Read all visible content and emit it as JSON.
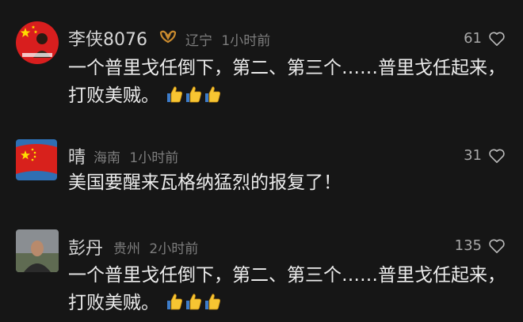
{
  "comments": [
    {
      "username": "李侠8076",
      "location": "辽宁",
      "time": "1小时前",
      "likes": "61",
      "text": "一个普里戈任倒下，第二、第三个……普里戈任起来，打败美贼。",
      "emoji": "thumbs-up x3",
      "badge": "sparkle-badge-icon"
    },
    {
      "username": "晴",
      "location": "海南",
      "time": "1小时前",
      "likes": "31",
      "text": "美国要醒来瓦格纳猛烈的报复了！"
    },
    {
      "username": "彭丹",
      "location": "贵州",
      "time": "2小时前",
      "likes": "135",
      "text": "一个普里戈任倒下，第二、第三个……普里戈任起来，打败美贼。",
      "emoji": "thumbs-up x3"
    }
  ],
  "colors": {
    "background": "#161616",
    "username": "#d6d6d6",
    "meta": "#7d7d7d",
    "text": "#ececec",
    "badge": "#c98a2e"
  }
}
